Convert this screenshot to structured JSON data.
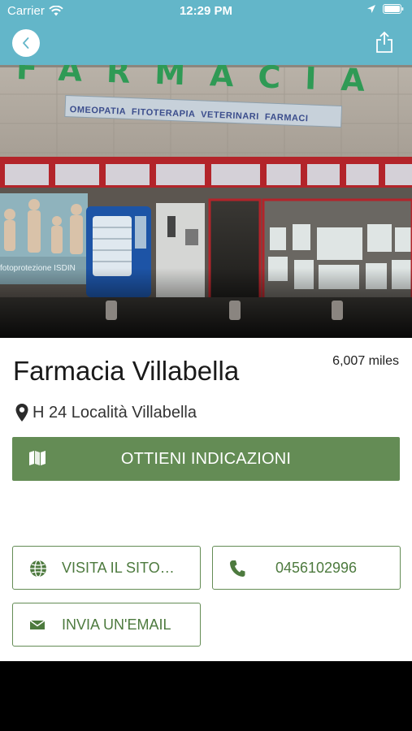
{
  "status_bar": {
    "carrier": "Carrier",
    "time": "12:29 PM"
  },
  "hero": {
    "sign_text": "FARMACIA",
    "banner_text": "OMEOPATIA  FITOTERAPIA  VETERINARI  FARMACI",
    "poster_text": "fotoprotezione ISDIN"
  },
  "pharmacy": {
    "name": "Farmacia Villabella",
    "distance": "6,007 miles",
    "address": "H 24 Località Villabella"
  },
  "actions": {
    "directions_label": "OTTIENI INDICAZIONI",
    "website_label": "VISITA IL SITO…",
    "phone_label": "0456102996",
    "email_label": "INVIA UN'EMAIL"
  },
  "colors": {
    "header": "#63b6c9",
    "accent_green": "#648c55",
    "text_green": "#4d7a3e"
  },
  "icons": [
    "wifi-icon",
    "location-arrow-icon",
    "battery-icon",
    "back-chevron-icon",
    "share-icon",
    "map-pin-icon",
    "map-icon",
    "globe-icon",
    "phone-icon",
    "mail-icon"
  ]
}
